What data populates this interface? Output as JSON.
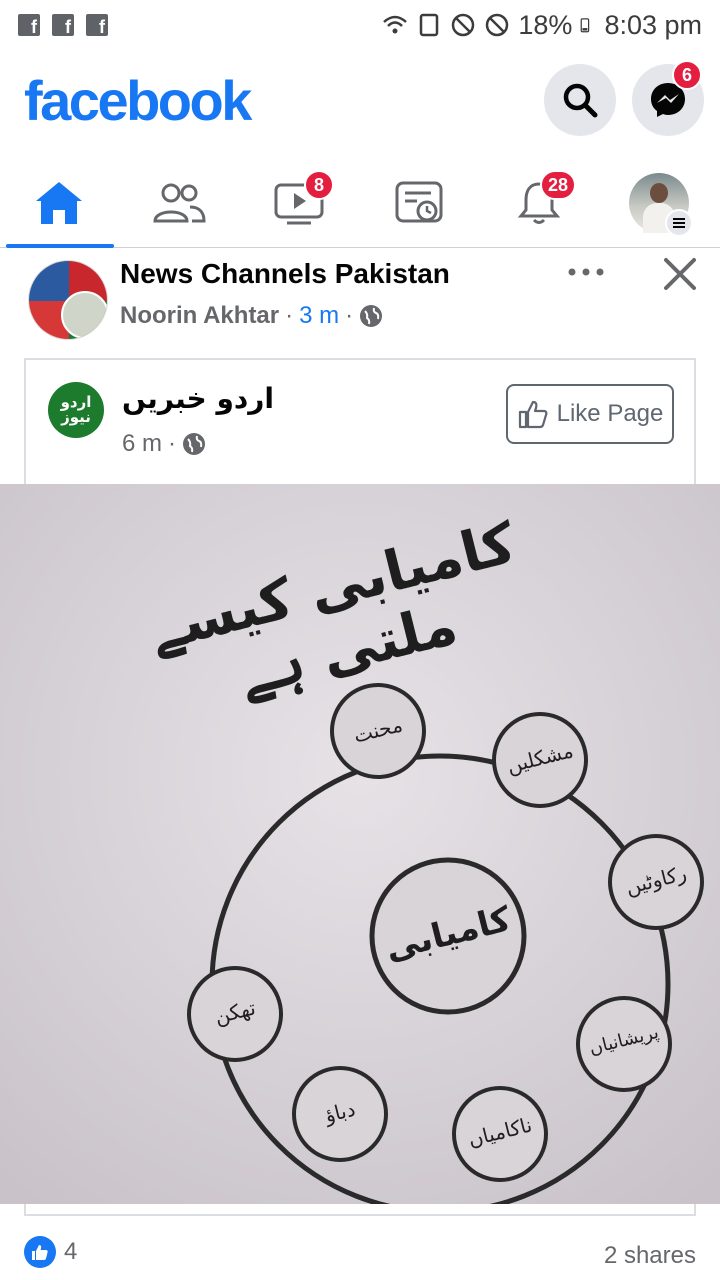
{
  "status_bar": {
    "battery": "18%",
    "time": "8:03 pm",
    "left_icons": [
      "facebook-notif-icon",
      "facebook-notif-icon",
      "facebook-notif-icon"
    ],
    "right_icons": [
      "wifi-icon",
      "sim-icon",
      "do-not-disturb-icon",
      "do-not-disturb-icon",
      "battery-icon"
    ]
  },
  "header": {
    "logo": "facebook",
    "messenger_badge": "6"
  },
  "nav": {
    "tabs": [
      {
        "name": "home",
        "icon": "home-icon",
        "active": true,
        "badge": ""
      },
      {
        "name": "friends",
        "icon": "friends-icon",
        "active": false,
        "badge": ""
      },
      {
        "name": "watch",
        "icon": "video-icon",
        "active": false,
        "badge": "8"
      },
      {
        "name": "feeds",
        "icon": "feed-icon",
        "active": false,
        "badge": ""
      },
      {
        "name": "notifications",
        "icon": "bell-icon",
        "active": false,
        "badge": "28"
      },
      {
        "name": "menu",
        "icon": "profile-menu-icon",
        "active": false,
        "badge": ""
      }
    ]
  },
  "post": {
    "group_name": "News Channels Pakistan",
    "author": "Noorin Akhtar",
    "time": "3 m",
    "separator": "·",
    "shared": {
      "page_name": "اردو خبریں",
      "avatar_text": "اردو نیوز",
      "time": "6 m",
      "like_page_label": "Like Page"
    },
    "image": {
      "heading": "کامیابی کیسے ملتی ہے",
      "center": "کامیابی",
      "outer_labels": [
        "محنت",
        "مشکلیں",
        "رکاوٹیں",
        "پریشانیاں",
        "ناکامیاں",
        "دباؤ",
        "تھکن"
      ]
    },
    "reaction_count": "4",
    "shares": "2 shares"
  },
  "colors": {
    "brand": "#1877f2",
    "badge": "#e41e3f",
    "secondary_text": "#65676b"
  }
}
